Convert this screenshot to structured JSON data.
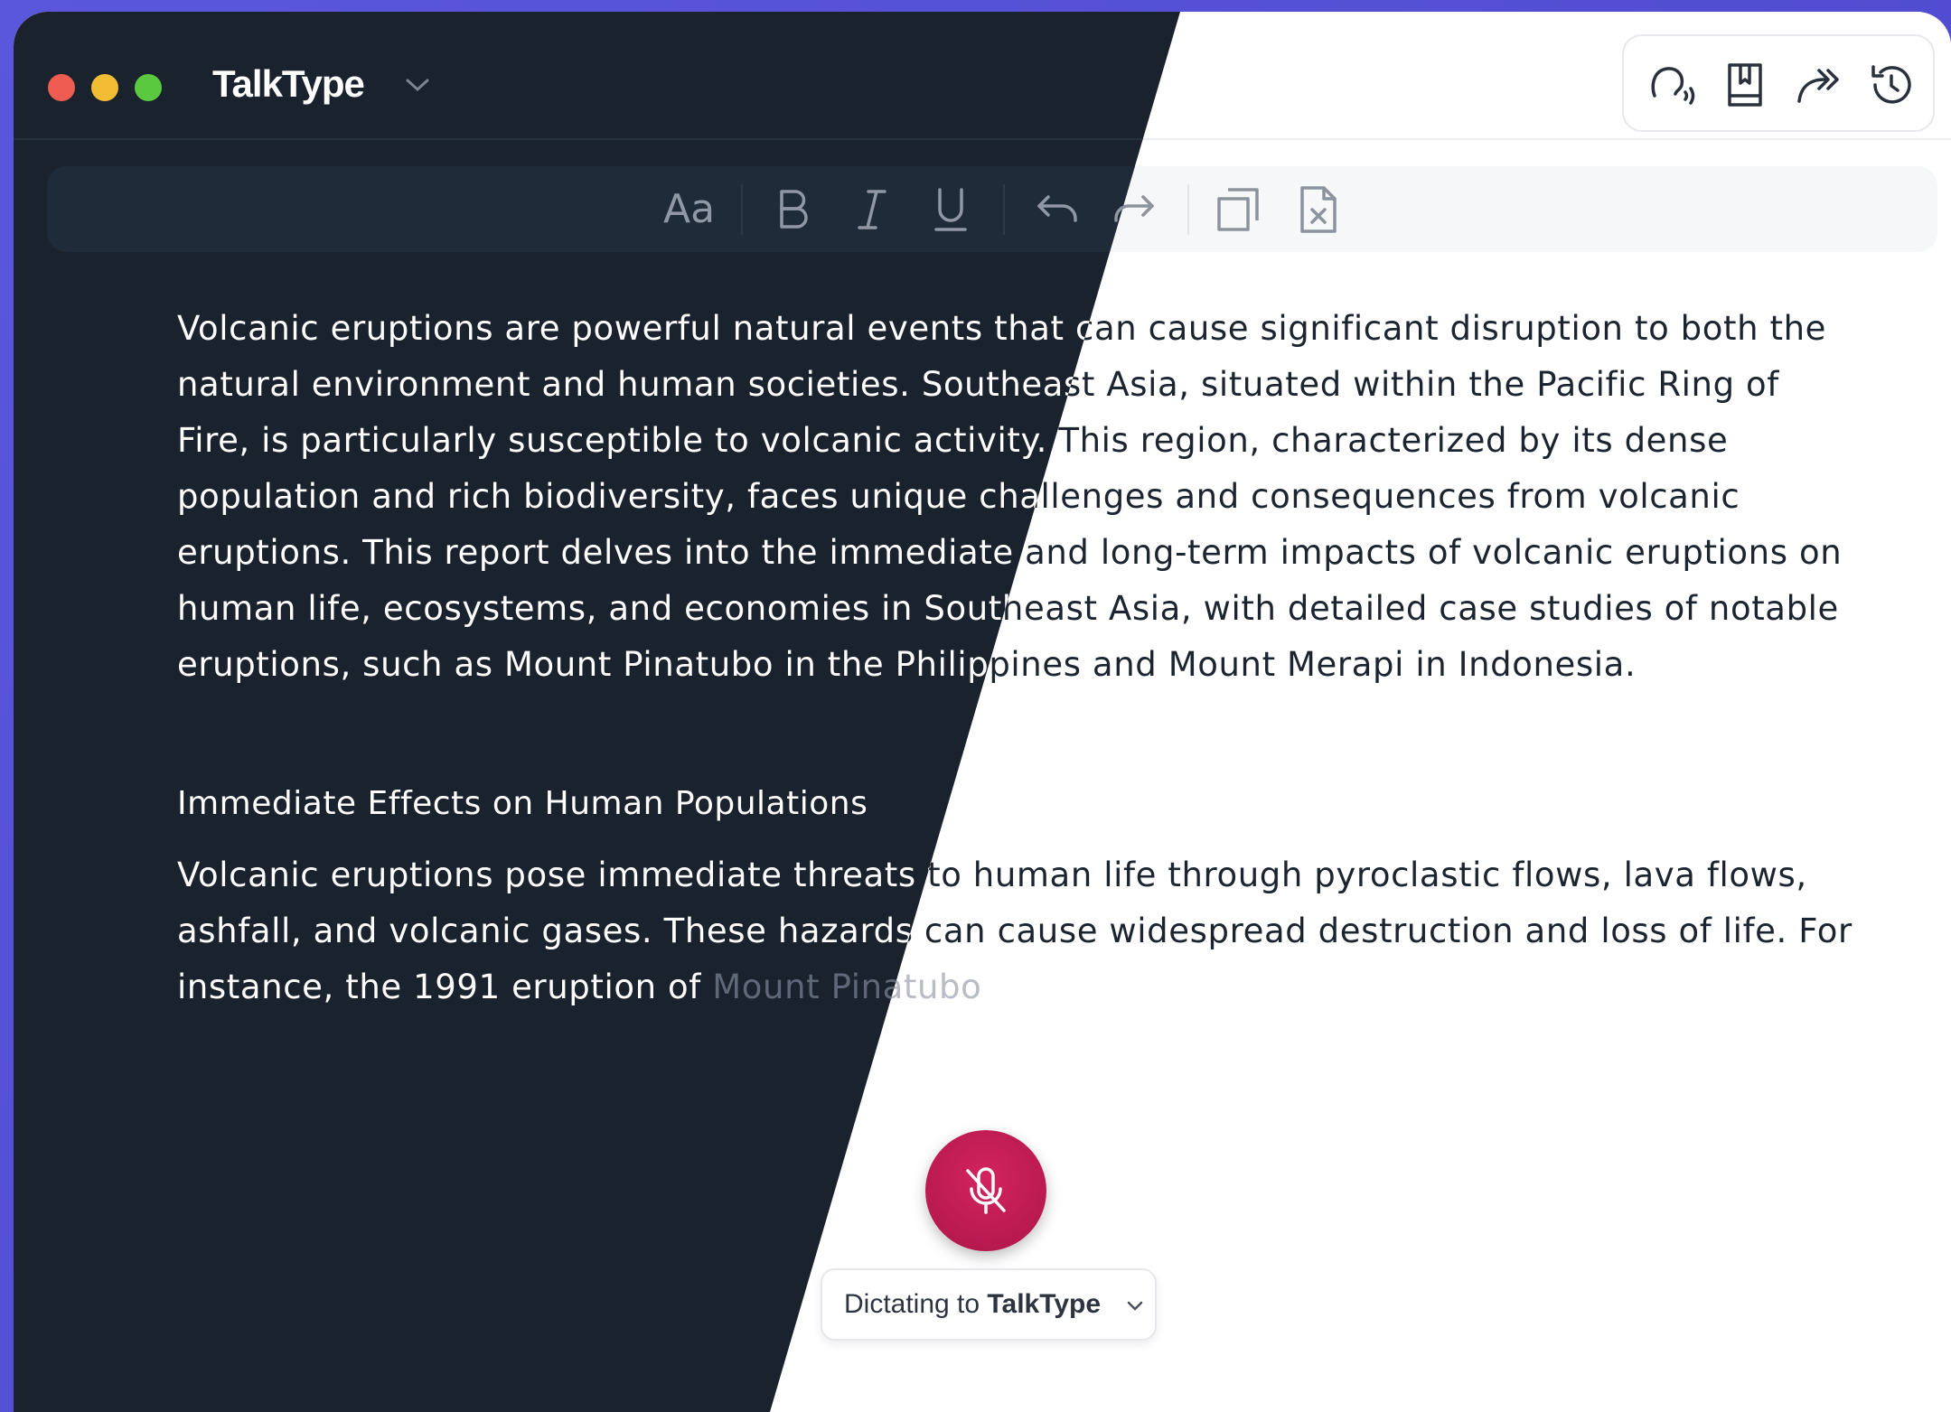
{
  "app": {
    "title": "TalkType"
  },
  "toolbar_right": {
    "icons": [
      "voice-icon",
      "bookmark-icon",
      "forward-icon",
      "history-icon"
    ]
  },
  "format_bar": {
    "font_label": "Aa",
    "icons": [
      "font-size-icon",
      "bold-icon",
      "italic-icon",
      "underline-icon",
      "undo-icon",
      "redo-icon",
      "copy-icon",
      "delete-document-icon"
    ]
  },
  "document": {
    "paragraph_1": "Volcanic eruptions are powerful natural events that can cause significant disruption to both the natural environment and human societies. Southeast Asia, situated within the Pacific Ring of Fire, is particularly susceptible to volcanic activity. This region, characterized by its dense population and rich biodiversity, faces unique challenges and consequences from volcanic eruptions. This report delves into the immediate and long-term impacts of volcanic eruptions on human life, ecosystems, and economies in Southeast Asia, with detailed case studies of notable eruptions, such as Mount Pinatubo in the Philippines and Mount Merapi in Indonesia.",
    "heading_1": "Immediate Effects on Human Populations",
    "paragraph_2": "Volcanic eruptions pose immediate threats to human life through pyroclastic flows, lava flows, ashfall, and volcanic gases. These hazards can cause widespread destruction and loss of life. For instance, the 1991 eruption of",
    "paragraph_2_pending": "Mount Pinatubo"
  },
  "dictation": {
    "prefix": "Dictating to",
    "target": "TalkType"
  },
  "colors": {
    "dark_bg": "#1a222d",
    "mic_accent": "#c01d55",
    "background": "#5b57dd"
  }
}
